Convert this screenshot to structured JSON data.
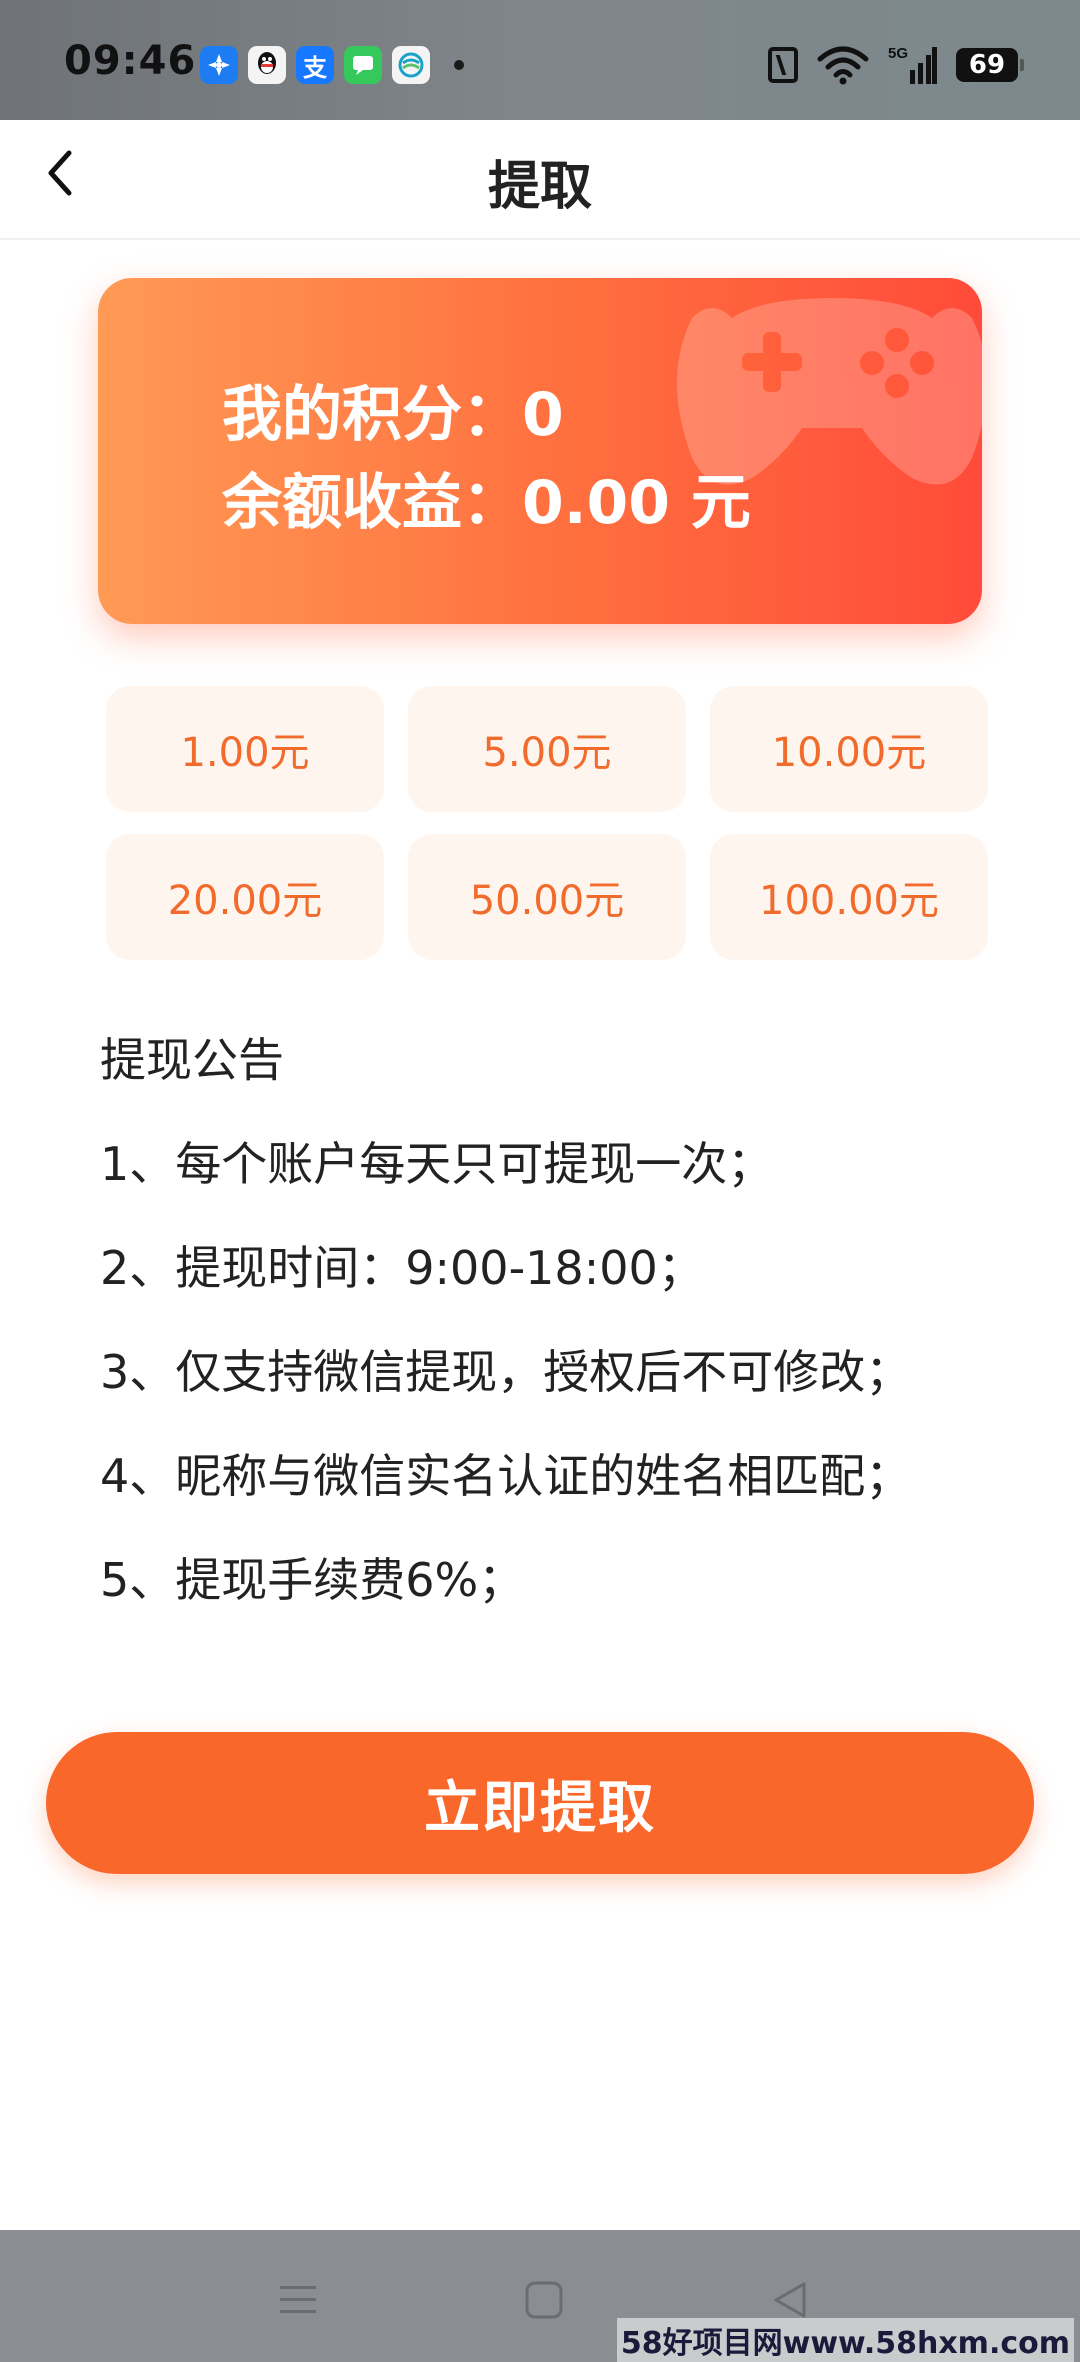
{
  "status_bar": {
    "time": "09:46",
    "app_icons": [
      "fengche-app-icon",
      "qq-icon",
      "alipay-icon",
      "messages-icon",
      "china-mobile-icon"
    ],
    "alipay_glyph": "支",
    "network": "5G",
    "battery": "69"
  },
  "header": {
    "title": "提取"
  },
  "card": {
    "points_label": "我的积分：0",
    "balance_label": "余额收益：0.00 元"
  },
  "amount_options": [
    "1.00元",
    "5.00元",
    "10.00元",
    "20.00元",
    "50.00元",
    "100.00元"
  ],
  "notice": {
    "title": "提现公告",
    "items": [
      "1、每个账户每天只可提现一次；",
      "2、提现时间：9:00-18:00；",
      "3、仅支持微信提现，授权后不可修改；",
      "4、昵称与微信实名认证的姓名相匹配；",
      "5、提现手续费6%；"
    ]
  },
  "submit_label": "立即提取",
  "watermark": "58好项目网www.58hxm.com",
  "colors": {
    "accent": "#f9672a",
    "card_start": "#ff9a55",
    "card_end": "#ff4b3a",
    "option_bg": "#fff5ef",
    "option_text": "#f16b2c"
  }
}
